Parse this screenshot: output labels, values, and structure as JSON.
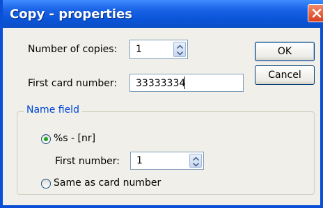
{
  "dialog": {
    "title": "Copy - properties"
  },
  "copies": {
    "label": "Number of copies:",
    "value": "1"
  },
  "first_card": {
    "label": "First card number:",
    "value": "33333334"
  },
  "buttons": {
    "ok": "OK",
    "cancel": "Cancel"
  },
  "name_field": {
    "title": "Name field",
    "option_pattern": "%s - [nr]",
    "first_number_label": "First number:",
    "first_number_value": "1",
    "option_same": "Same as card number",
    "selected": "option_pattern"
  },
  "icons": {
    "close": "close-icon",
    "spin_up": "arrow-up-icon",
    "spin_down": "arrow-down-icon"
  },
  "colors": {
    "titlebar": "#0a55d8",
    "group_title": "#0046d5",
    "radio_selected": "#21a121"
  }
}
